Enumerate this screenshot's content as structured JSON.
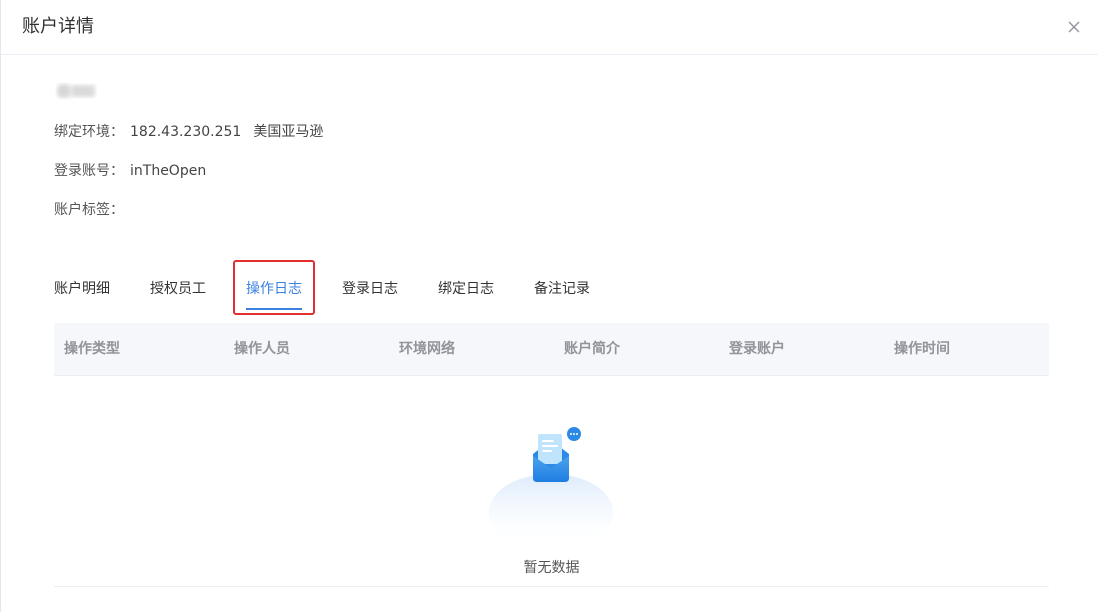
{
  "modal": {
    "title": "账户详情"
  },
  "account": {
    "bind_env_label": "绑定环境：",
    "bind_env_ip": "182.43.230.251",
    "bind_env_region": "美国亚马逊",
    "login_label": "登录账号：",
    "login_value": "inTheOpen",
    "tags_label": "账户标签："
  },
  "tabs": [
    {
      "label": "账户明细"
    },
    {
      "label": "授权员工"
    },
    {
      "label": "操作日志",
      "active": true
    },
    {
      "label": "登录日志"
    },
    {
      "label": "绑定日志"
    },
    {
      "label": "备注记录"
    }
  ],
  "table": {
    "columns": [
      "操作类型",
      "操作人员",
      "环境网络",
      "账户简介",
      "登录账户",
      "操作时间"
    ],
    "rows": [],
    "empty_text": "暂无数据"
  },
  "colors": {
    "accent": "#3b82e0",
    "highlight": "#e03030",
    "header_bg": "#f5f7fa"
  },
  "icons": {
    "close": "close-icon",
    "empty": "empty-inbox-icon"
  }
}
